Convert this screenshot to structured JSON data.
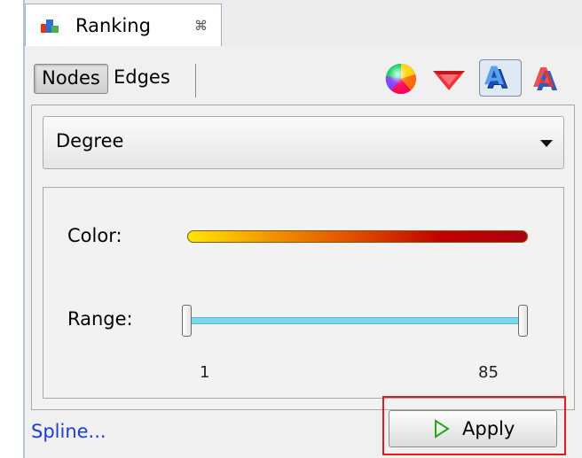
{
  "window": {
    "tab_title": "Ranking",
    "tab_close_glyph": "⌘"
  },
  "toolbar": {
    "nodes_label": "Nodes",
    "edges_label": "Edges",
    "icons": [
      "color-ranking-icon",
      "size-ranking-icon",
      "label-color-ranking-icon",
      "label-size-ranking-icon"
    ]
  },
  "ranking": {
    "selected_attribute": "Degree",
    "color_label": "Color:",
    "range_label": "Range:",
    "range_min": "1",
    "range_max": "85",
    "gradient_colors": [
      "#ffe600",
      "#f39200",
      "#e04a00",
      "#c00000",
      "#b00010"
    ]
  },
  "footer": {
    "spline_label": "Spline...",
    "apply_label": "Apply"
  },
  "accent": {
    "highlight": "#e2191f",
    "link": "#1a3fcf",
    "range_track": "#7fd6ef",
    "apply_icon": "#2aa61a"
  }
}
